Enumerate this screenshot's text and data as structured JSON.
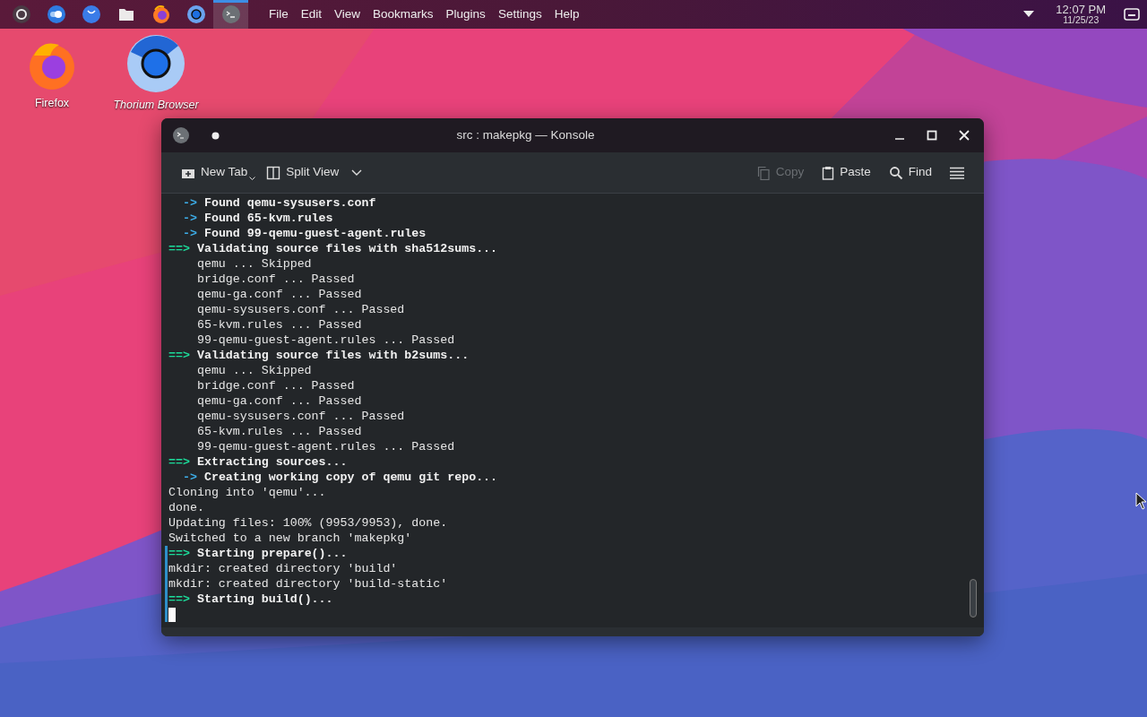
{
  "taskbar": [
    {
      "kind": "launcher",
      "selected": false
    },
    {
      "kind": "toggle",
      "selected": false
    },
    {
      "kind": "store",
      "selected": false
    },
    {
      "kind": "files",
      "selected": false
    },
    {
      "kind": "firefox",
      "selected": false
    },
    {
      "kind": "thorium",
      "selected": false
    },
    {
      "kind": "terminal",
      "selected": true
    }
  ],
  "menu": [
    "File",
    "Edit",
    "View",
    "Bookmarks",
    "Plugins",
    "Settings",
    "Help"
  ],
  "clock": {
    "time": "12:07 PM",
    "date": "11/25/23"
  },
  "desktop_icons": [
    {
      "kind": "firefox",
      "label": "Firefox",
      "italic": false
    },
    {
      "kind": "thorium",
      "label": "Thorium Browser",
      "italic": true
    }
  ],
  "window": {
    "title": "src : makepkg — Konsole",
    "toolbar": [
      {
        "kind": "new-tab",
        "label": "New Tab",
        "disabled": false
      },
      {
        "kind": "split",
        "label": "Split View",
        "disabled": false
      },
      {
        "kind": "copy",
        "label": "Copy",
        "disabled": true
      },
      {
        "kind": "paste",
        "label": "Paste",
        "disabled": false
      },
      {
        "kind": "find",
        "label": "Find",
        "disabled": false
      }
    ],
    "lines": [
      {
        "kind": "sub",
        "marker": "->",
        "text": "Found qemu-sysusers.conf",
        "marked": false
      },
      {
        "kind": "sub",
        "marker": "->",
        "text": "Found 65-kvm.rules",
        "marked": false
      },
      {
        "kind": "sub",
        "marker": "->",
        "text": "Found 99-qemu-guest-agent.rules",
        "marked": false
      },
      {
        "kind": "stage",
        "marker": "==>",
        "text": "Validating source files with sha512sums...",
        "marked": false
      },
      {
        "kind": "detail",
        "text": "qemu ... Skipped",
        "marked": false
      },
      {
        "kind": "detail",
        "text": "bridge.conf ... Passed",
        "marked": false
      },
      {
        "kind": "detail",
        "text": "qemu-ga.conf ... Passed",
        "marked": false
      },
      {
        "kind": "detail",
        "text": "qemu-sysusers.conf ... Passed",
        "marked": false
      },
      {
        "kind": "detail",
        "text": "65-kvm.rules ... Passed",
        "marked": false
      },
      {
        "kind": "detail",
        "text": "99-qemu-guest-agent.rules ... Passed",
        "marked": false
      },
      {
        "kind": "stage",
        "marker": "==>",
        "text": "Validating source files with b2sums...",
        "marked": false
      },
      {
        "kind": "detail",
        "text": "qemu ... Skipped",
        "marked": false
      },
      {
        "kind": "detail",
        "text": "bridge.conf ... Passed",
        "marked": false
      },
      {
        "kind": "detail",
        "text": "qemu-ga.conf ... Passed",
        "marked": false
      },
      {
        "kind": "detail",
        "text": "qemu-sysusers.conf ... Passed",
        "marked": false
      },
      {
        "kind": "detail",
        "text": "65-kvm.rules ... Passed",
        "marked": false
      },
      {
        "kind": "detail",
        "text": "99-qemu-guest-agent.rules ... Passed",
        "marked": false
      },
      {
        "kind": "stage",
        "marker": "==>",
        "text": "Extracting sources...",
        "marked": false
      },
      {
        "kind": "sub",
        "marker": "->",
        "text": "Creating working copy of qemu git repo...",
        "marked": false
      },
      {
        "kind": "plain",
        "text": "Cloning into 'qemu'...",
        "marked": false
      },
      {
        "kind": "plain",
        "text": "done.",
        "marked": false
      },
      {
        "kind": "plain",
        "text": "Updating files: 100% (9953/9953), done.",
        "marked": false
      },
      {
        "kind": "plain",
        "text": "Switched to a new branch 'makepkg'",
        "marked": false
      },
      {
        "kind": "stage",
        "marker": "==>",
        "text": "Starting prepare()...",
        "marked": true
      },
      {
        "kind": "plain",
        "text": "mkdir: created directory 'build'",
        "marked": true
      },
      {
        "kind": "plain",
        "text": "mkdir: created directory 'build-static'",
        "marked": true
      },
      {
        "kind": "stage",
        "marker": "==>",
        "text": "Starting build()...",
        "marked": true
      },
      {
        "kind": "cursor",
        "marked": true
      }
    ]
  }
}
